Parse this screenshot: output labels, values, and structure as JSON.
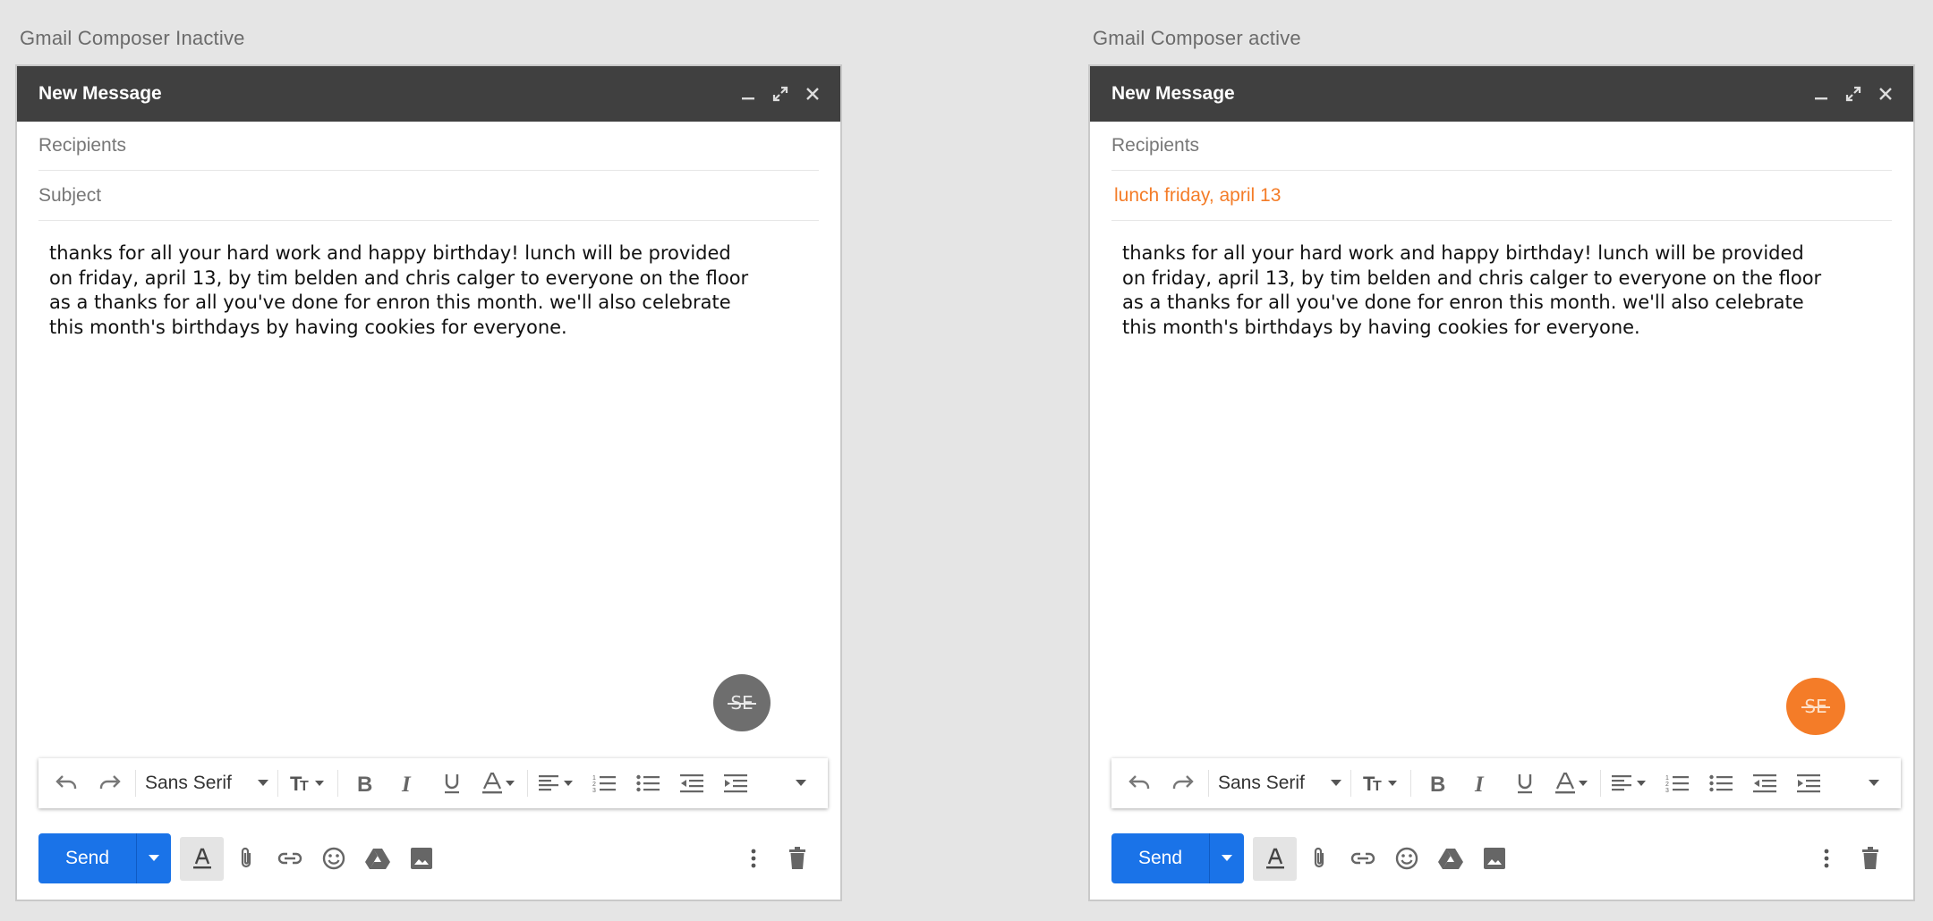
{
  "panels": {
    "inactive": {
      "caption": "Gmail Composer Inactive",
      "title": "New Message",
      "recipients_placeholder": "Recipients",
      "subject": "Subject",
      "body": "thanks for all your hard work and happy birthday! lunch will be provided on friday, april 13, by tim belden and chris calger to everyone on the floor as a thanks for all you've done for enron this month. we'll also celebrate this month's birthdays by having cookies for everyone.",
      "fab_label": "SE",
      "fab_color": "#6e6e6e"
    },
    "active": {
      "caption": "Gmail Composer active",
      "title": "New Message",
      "recipients_placeholder": "Recipients",
      "subject": "lunch friday, april 13",
      "subject_color": "#f47c28",
      "body": "thanks for all your hard work and happy birthday! lunch will be provided on friday, april 13, by tim belden and chris calger to everyone on the floor as a thanks for all you've done for enron this month. we'll also celebrate this month's birthdays by having cookies for everyone.",
      "fab_label": "SE",
      "fab_color": "#f47c28"
    }
  },
  "toolbar": {
    "font_name": "Sans Serif",
    "icons": [
      "undo-icon",
      "redo-icon",
      "font-dropdown",
      "text-size-icon",
      "bold-icon",
      "italic-icon",
      "underline-icon",
      "text-color-icon",
      "align-icon",
      "numbered-list-icon",
      "bulleted-list-icon",
      "indent-less-icon",
      "indent-more-icon",
      "more-formatting-icon"
    ]
  },
  "bottom": {
    "send_label": "Send",
    "icons": [
      "formatting-options-icon",
      "attach-icon",
      "link-icon",
      "emoji-icon",
      "drive-icon",
      "photo-icon",
      "more-options-icon",
      "discard-icon"
    ]
  },
  "colors": {
    "send": "#1a73e8",
    "titlebar": "#404040",
    "accent": "#f47c28"
  }
}
